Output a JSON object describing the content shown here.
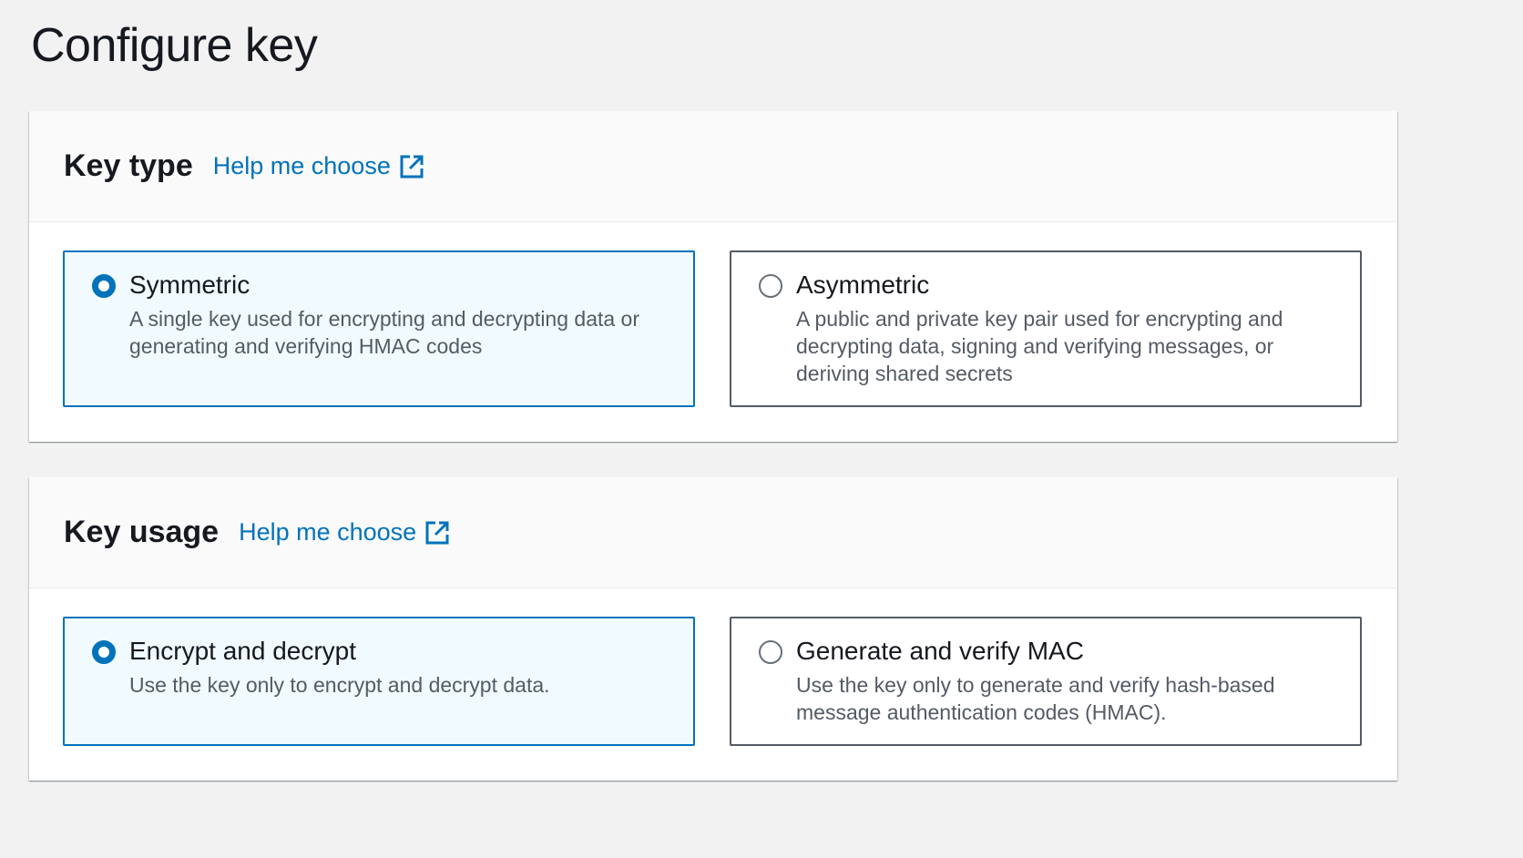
{
  "page": {
    "title": "Configure key"
  },
  "key_type": {
    "heading": "Key type",
    "help_link": "Help me choose",
    "options": [
      {
        "label": "Symmetric",
        "description": "A single key used for encrypting and decrypting data or generating and verifying HMAC codes",
        "selected": true
      },
      {
        "label": "Asymmetric",
        "description": "A public and private key pair used for encrypting and decrypting data, signing and verifying messages, or deriving shared secrets",
        "selected": false
      }
    ]
  },
  "key_usage": {
    "heading": "Key usage",
    "help_link": "Help me choose",
    "options": [
      {
        "label": "Encrypt and decrypt",
        "description": "Use the key only to encrypt and decrypt data.",
        "selected": true
      },
      {
        "label": "Generate and verify MAC",
        "description": "Use the key only to generate and verify hash-based message authentication codes (HMAC).",
        "selected": false
      }
    ]
  },
  "colors": {
    "accent": "#0073bb",
    "selected_bg": "#f1faff",
    "page_bg": "#f2f2f2"
  },
  "icons": {
    "help_link": "external-link-icon"
  }
}
